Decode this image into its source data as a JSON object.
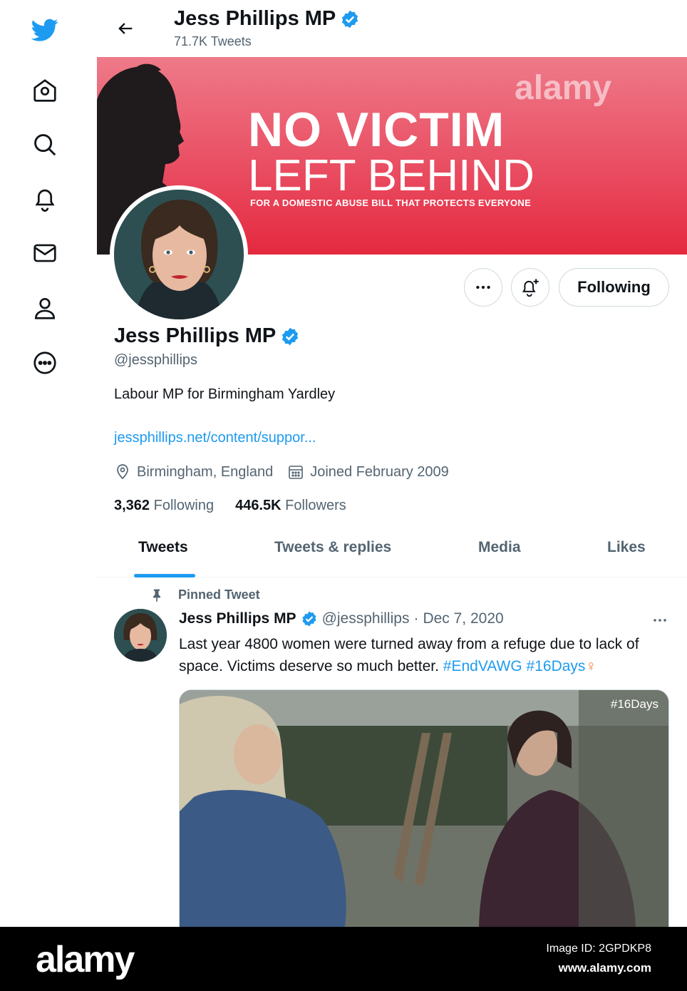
{
  "nav": {
    "items": [
      {
        "icon": "twitter-logo-icon"
      },
      {
        "icon": "home-icon"
      },
      {
        "icon": "explore-search-icon"
      },
      {
        "icon": "notifications-bell-icon"
      },
      {
        "icon": "messages-mail-icon"
      },
      {
        "icon": "profile-person-icon"
      },
      {
        "icon": "more-circle-icon"
      }
    ]
  },
  "header": {
    "name": "Jess Phillips MP",
    "tweet_count": "71.7K Tweets"
  },
  "banner": {
    "line1": "NO VICTIM",
    "line2": "LEFT BEHIND",
    "line3": "FOR A DOMESTIC ABUSE BILL THAT PROTECTS EVERYONE",
    "watermark": "alamy"
  },
  "profile": {
    "name": "Jess Phillips MP",
    "handle": "@jessphillips",
    "bio": "Labour MP for Birmingham Yardley",
    "link": "jessphillips.net/content/suppor...",
    "location": "Birmingham, England",
    "joined": "Joined February 2009",
    "following_count": "3,362",
    "following_label": "Following",
    "followers_count": "446.5K",
    "followers_label": "Followers",
    "follow_button": "Following"
  },
  "tabs": [
    "Tweets",
    "Tweets & replies",
    "Media",
    "Likes"
  ],
  "tweet": {
    "pinned_label": "Pinned Tweet",
    "author": "Jess Phillips MP",
    "handle": "@jessphillips",
    "separator": "·",
    "date": "Dec 7, 2020",
    "text": "Last year 4800 women were turned away from a refuge due to lack of space. Victims deserve so much better.",
    "hashtag1": "#EndVAWG",
    "hashtag2": "#16Days",
    "emoji": "♀",
    "media_tag": "#16Days"
  },
  "footer": {
    "logo": "alamy",
    "image_id": "Image ID: 2GPDKP8",
    "url": "www.alamy.com"
  },
  "colors": {
    "accent": "#1d9bf0",
    "banner_red": "#e4293f",
    "muted_text": "#536471"
  }
}
